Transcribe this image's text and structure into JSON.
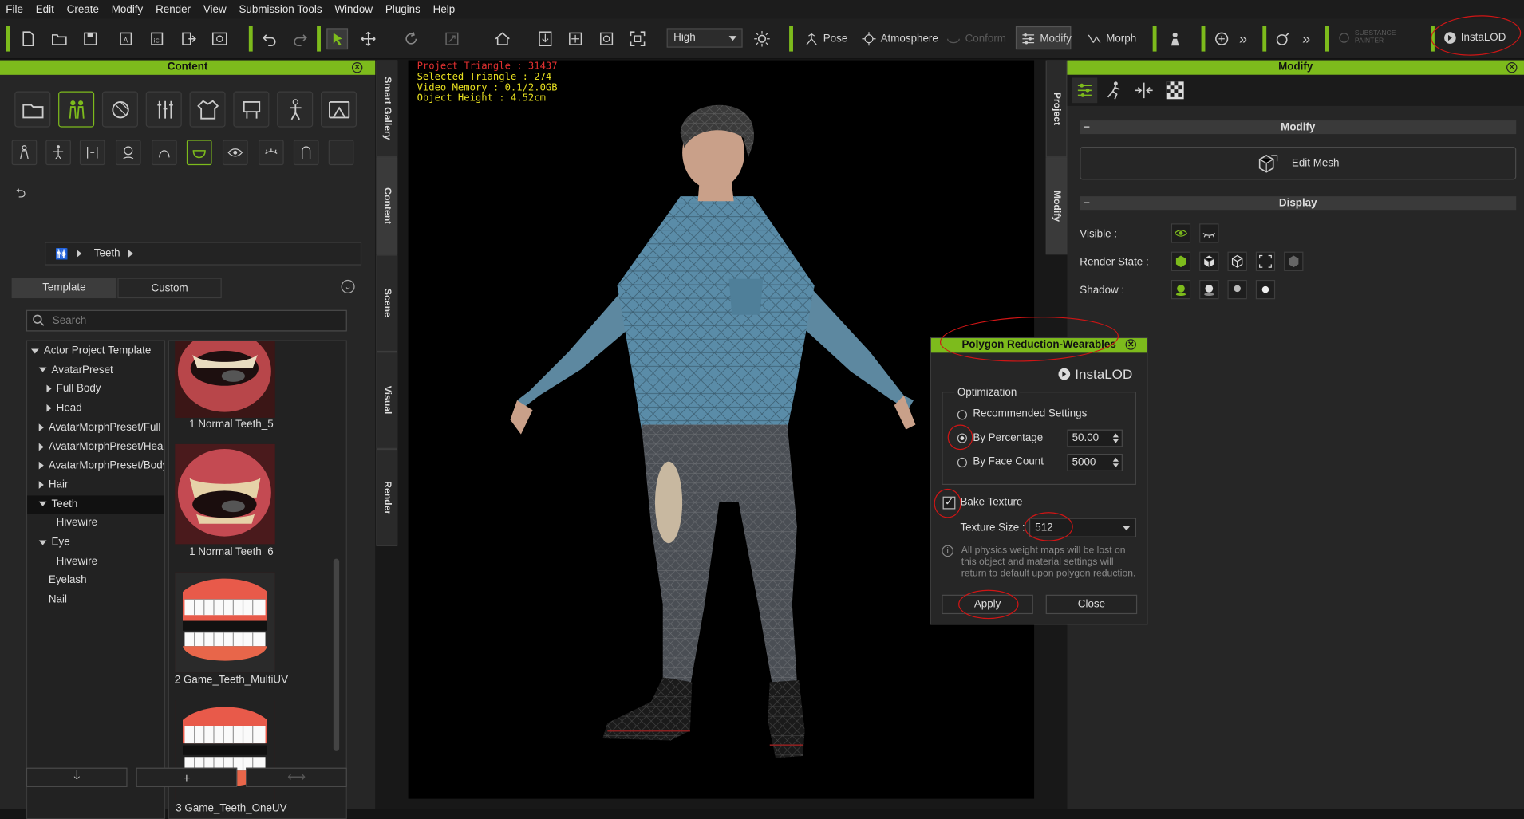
{
  "menu": [
    "File",
    "Edit",
    "Create",
    "Modify",
    "Render",
    "View",
    "Submission Tools",
    "Window",
    "Plugins",
    "Help"
  ],
  "toolbar": {
    "quality": "High",
    "pose": "Pose",
    "atmosphere": "Atmosphere",
    "conform": "Conform",
    "modify": "Modify",
    "morph": "Morph",
    "substance": "SUBSTANCE PAINTER",
    "instalod": "InstaLOD"
  },
  "content_panel": {
    "title": "Content",
    "breadcrumb": "Teeth",
    "tabs": [
      "Template",
      "Custom"
    ],
    "search_placeholder": "Search",
    "tree": [
      {
        "label": "Actor Project Template",
        "level": 0,
        "arrow": "down"
      },
      {
        "label": "AvatarPreset",
        "level": 1,
        "arrow": "down"
      },
      {
        "label": "Full Body",
        "level": 2,
        "arrow": "right"
      },
      {
        "label": "Head",
        "level": 2,
        "arrow": "right"
      },
      {
        "label": "AvatarMorphPreset/Full ...",
        "level": 1,
        "arrow": "right"
      },
      {
        "label": "AvatarMorphPreset/Head",
        "level": 1,
        "arrow": "right"
      },
      {
        "label": "AvatarMorphPreset/Body",
        "level": 1,
        "arrow": "right"
      },
      {
        "label": "Hair",
        "level": 1,
        "arrow": "right"
      },
      {
        "label": "Teeth",
        "level": 1,
        "arrow": "down",
        "selected": true
      },
      {
        "label": "Hivewire",
        "level": 2,
        "arrow": ""
      },
      {
        "label": "Eye",
        "level": 1,
        "arrow": "down"
      },
      {
        "label": "Hivewire",
        "level": 2,
        "arrow": ""
      },
      {
        "label": "Eyelash",
        "level": 1,
        "arrow": ""
      },
      {
        "label": "Nail",
        "level": 1,
        "arrow": ""
      }
    ],
    "thumbnails": [
      "1 Normal Teeth_5",
      "1 Normal Teeth_6",
      "2 Game_Teeth_MultiUV",
      "3 Game_Teeth_OneUV"
    ]
  },
  "side_tabs": [
    "Smart Gallery",
    "Content",
    "Scene",
    "Visual",
    "Render"
  ],
  "right_side_tabs": [
    "Project",
    "Modify"
  ],
  "viewport": {
    "project_triangle": "Project Triangle : 31437",
    "selected_triangle": "Selected Triangle : 274",
    "video_memory": "Video Memory : 0.1/2.0GB",
    "object_height": "Object Height : 4.52cm"
  },
  "modify_panel": {
    "title": "Modify",
    "modify_section": "Modify",
    "edit_mesh": "Edit Mesh",
    "display_section": "Display",
    "visible": "Visible :",
    "render_state": "Render State :",
    "shadow": "Shadow :"
  },
  "dialog": {
    "title": "Polygon Reduction-Wearables",
    "brand": "InstaLOD",
    "optimization": "Optimization",
    "recommended": "Recommended Settings",
    "by_percentage": "By Percentage",
    "percentage_value": "50.00",
    "by_face_count": "By Face Count",
    "face_count_value": "5000",
    "bake_texture": "Bake Texture",
    "texture_size_label": "Texture Size :",
    "texture_size": "512",
    "info": "All physics weight maps will be lost on this object and material settings will return to default upon polygon reduction.",
    "apply": "Apply",
    "close": "Close"
  },
  "colors": {
    "accent": "#7dbb1c",
    "annotation": "#d01515",
    "project_triangle": "#e03030",
    "stats": "#e8e020"
  }
}
